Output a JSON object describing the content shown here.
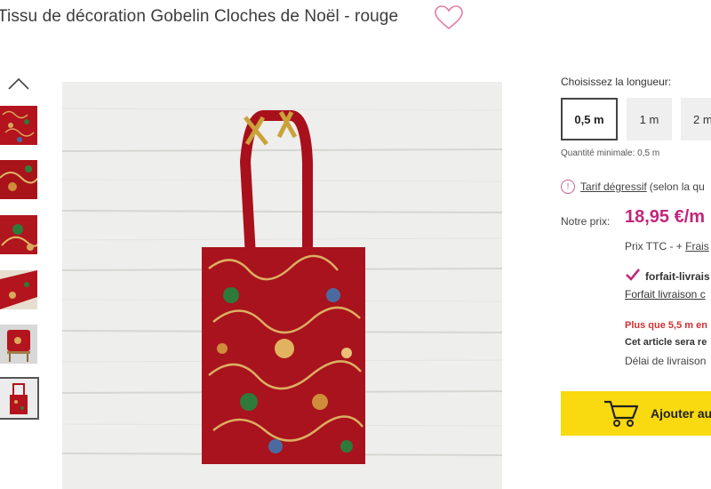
{
  "product": {
    "title": "Tissu de décoration Gobelin Cloches de Noël - rouge",
    "wishlist_icon": "heart-outline-icon"
  },
  "gallery": {
    "up_icon": "chevron-up-icon",
    "thumbnails": [
      "thumb-1",
      "thumb-2",
      "thumb-3",
      "thumb-4",
      "thumb-5",
      "thumb-6"
    ],
    "selected_index": 5
  },
  "length": {
    "label": "Choisissez la longueur:",
    "options": [
      "0,5 m",
      "1 m",
      "2 m"
    ],
    "selected": "0,5 m",
    "min_qty": "Quantité minimale: 0,5 m"
  },
  "tarif": {
    "icon": "info-icon",
    "link": "Tarif dégressif",
    "suffix": "(selon la qu"
  },
  "price": {
    "label": "Notre prix:",
    "value": "18,95 €/m",
    "ttc_prefix": "Prix TTC - + ",
    "ttc_link": "Frais "
  },
  "shipping": {
    "check_icon": "checkmark-icon",
    "title": "forfait-livrais",
    "link": "Forfait livraison c",
    "stock_warning": "Plus que 5,5 m en",
    "note": "Cet article sera re",
    "delay": "Délai de livraison"
  },
  "cart": {
    "icon": "cart-icon",
    "label": "Ajouter au"
  },
  "colors": {
    "accent_price": "#c2267a",
    "cart_button": "#f9d90f",
    "stock_warning": "#d32f2f",
    "fabric_red": "#b3141d"
  }
}
